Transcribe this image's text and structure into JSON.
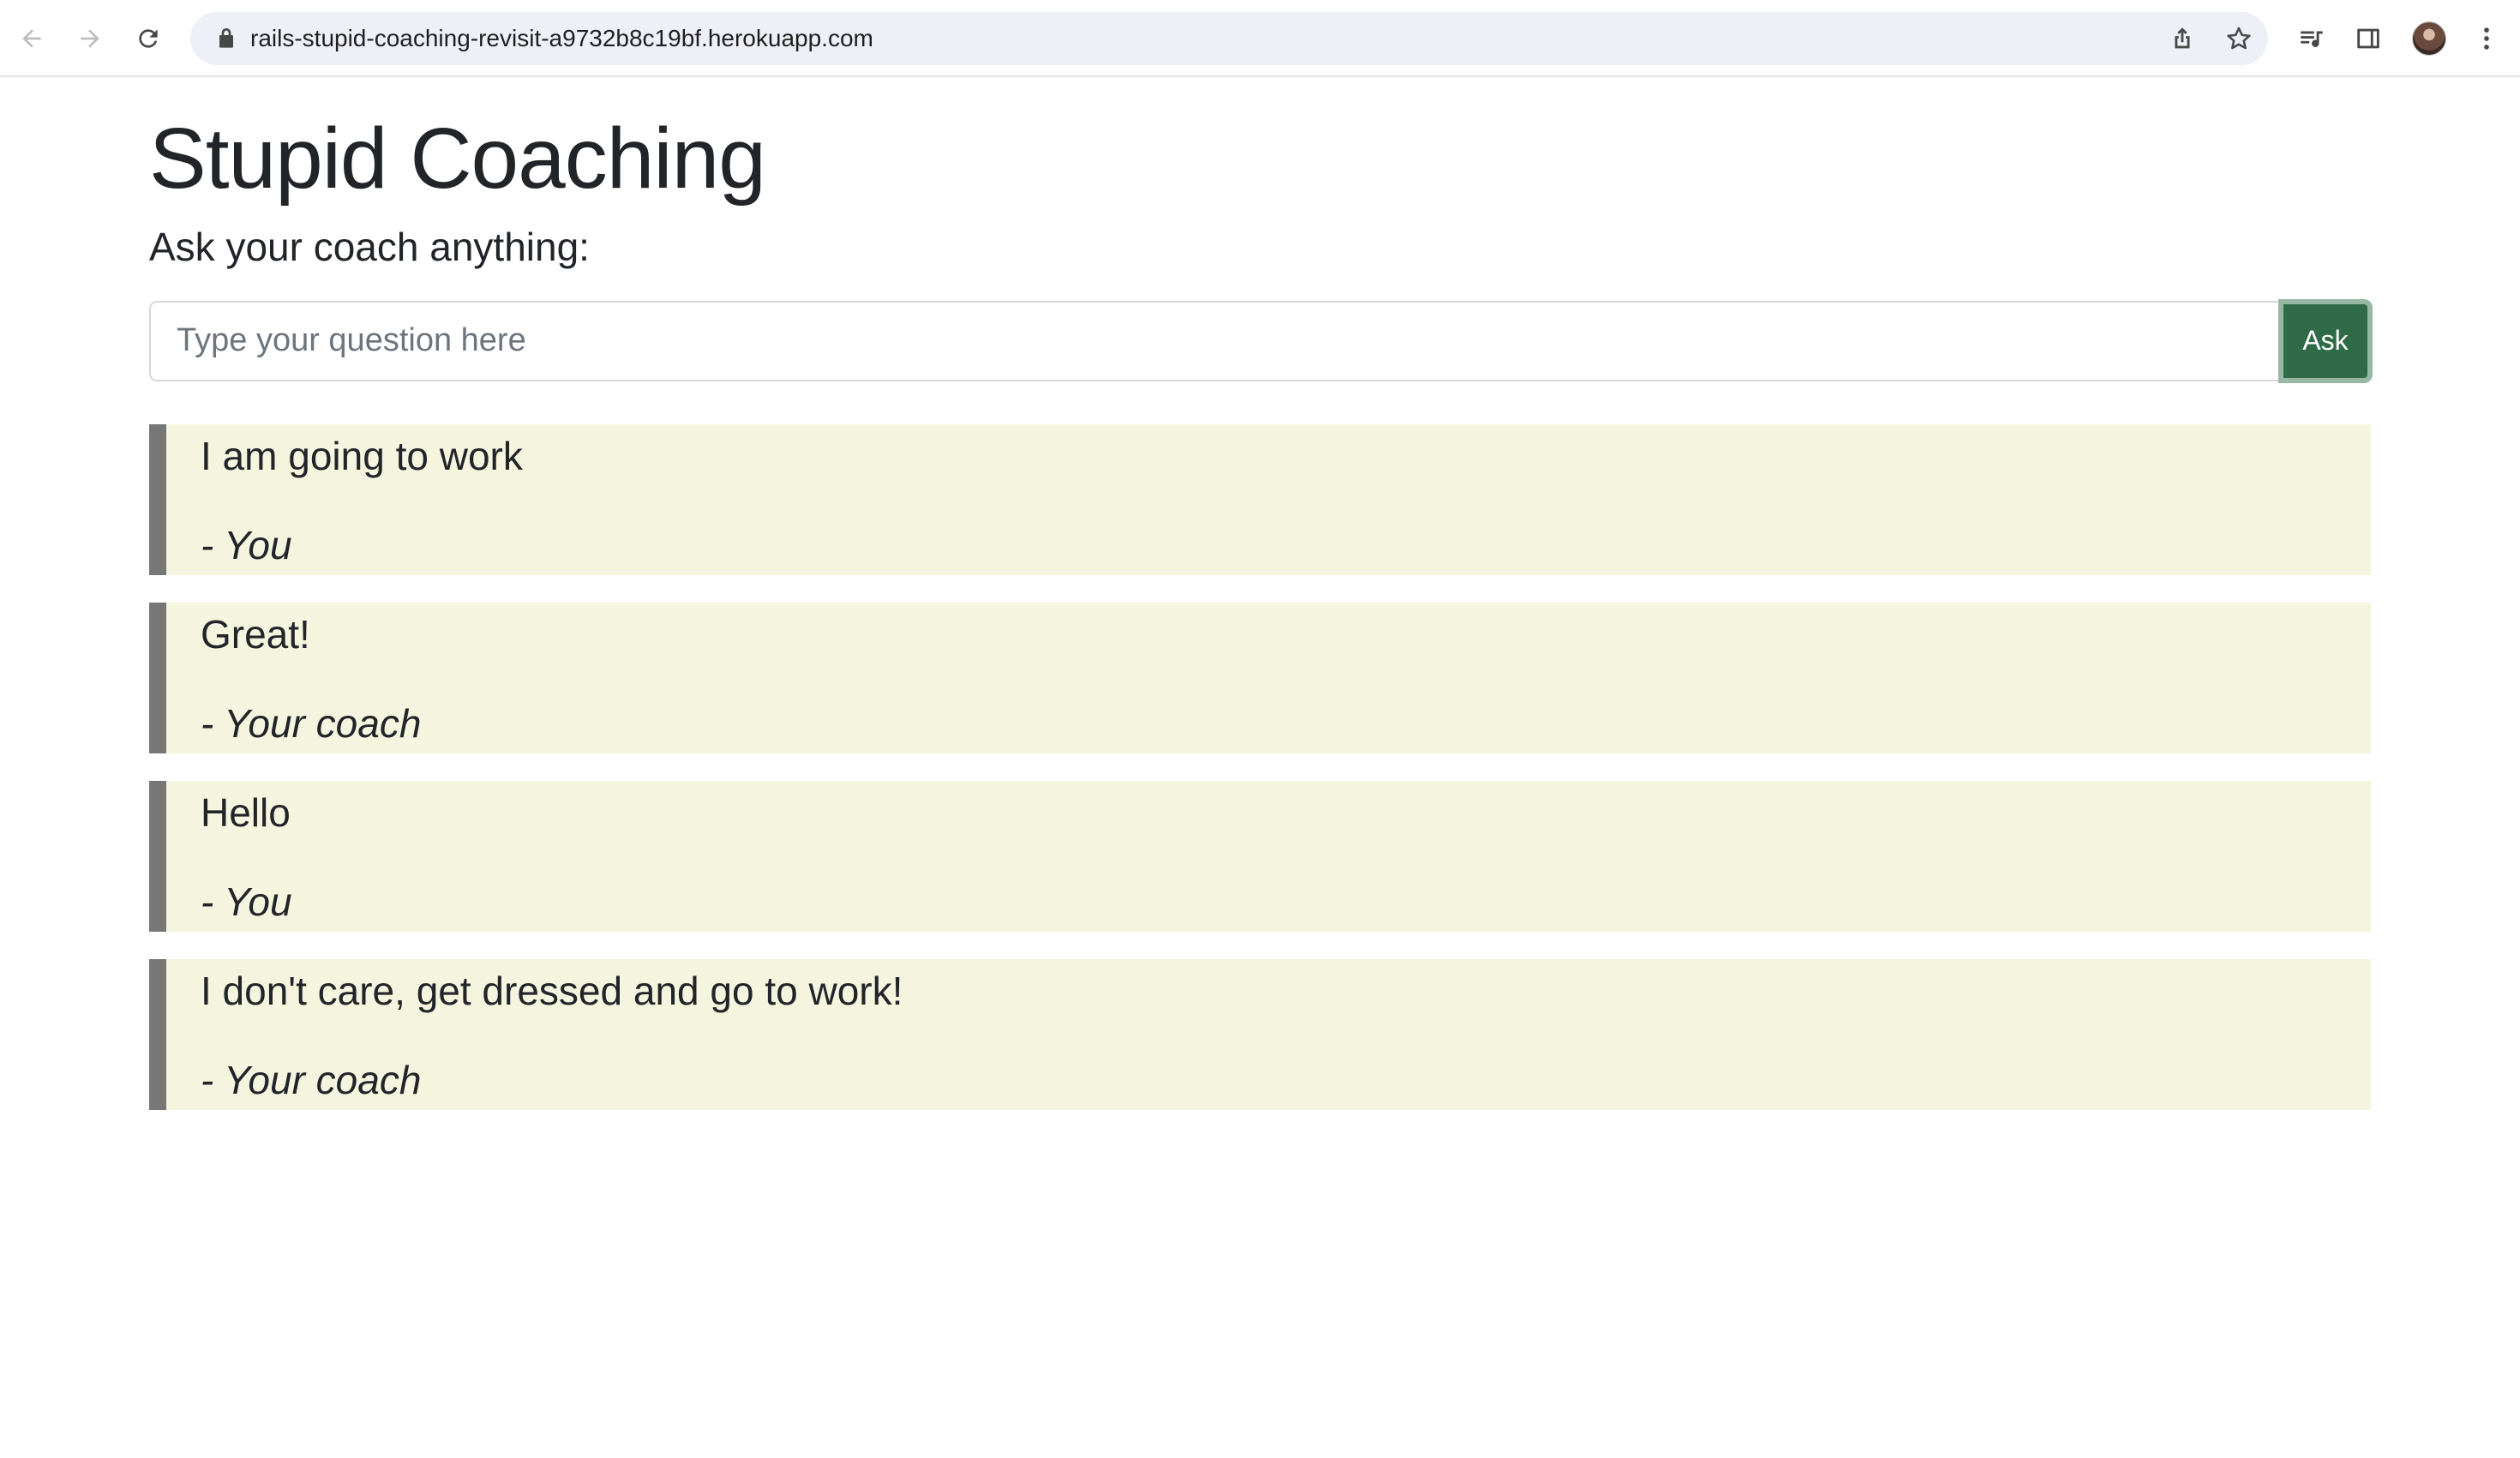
{
  "browser": {
    "url": "rails-stupid-coaching-revisit-a9732b8c19bf.herokuapp.com",
    "icons": [
      "back-icon",
      "forward-icon",
      "reload-icon",
      "lock-icon",
      "share-icon",
      "star-icon",
      "media-icon",
      "side-panel-icon",
      "profile-avatar",
      "menu-icon"
    ]
  },
  "page": {
    "title": "Stupid Coaching",
    "prompt": "Ask your coach anything:",
    "input_placeholder": "Type your question here",
    "input_value": "",
    "ask_label": "Ask"
  },
  "messages": [
    {
      "text": "I am going to work",
      "author": "- You"
    },
    {
      "text": "Great!",
      "author": "- Your coach"
    },
    {
      "text": "Hello",
      "author": "- You"
    },
    {
      "text": "I don't care, get dressed and go to work!",
      "author": "- Your coach"
    }
  ],
  "colors": {
    "message_bg": "#f5f4de",
    "message_border": "#777777",
    "ask_button": "#2f6b47"
  }
}
